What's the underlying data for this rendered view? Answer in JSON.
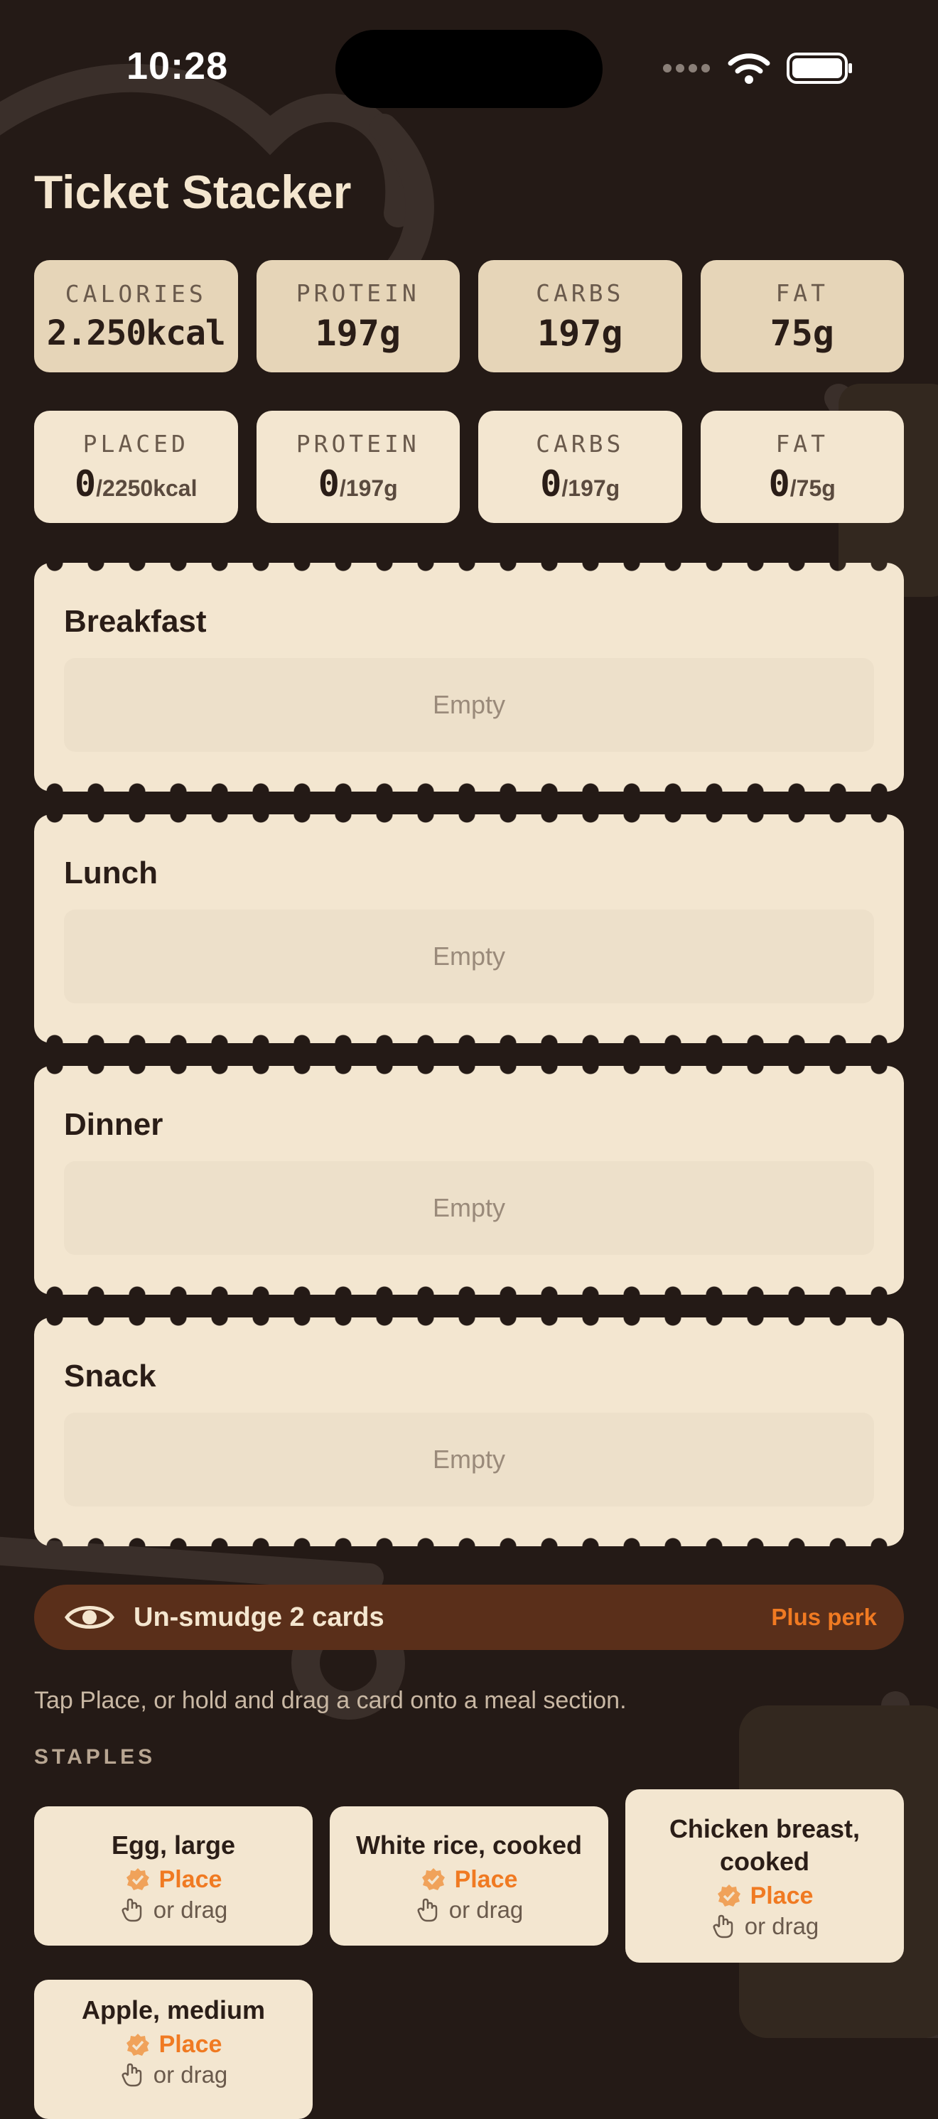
{
  "status_bar": {
    "time": "10:28"
  },
  "app": {
    "title": "Ticket Stacker"
  },
  "targets": [
    {
      "label": "CALORIES",
      "value": "2.250kcal"
    },
    {
      "label": "PROTEIN",
      "value": "197g"
    },
    {
      "label": "CARBS",
      "value": "197g"
    },
    {
      "label": "FAT",
      "value": "75g"
    }
  ],
  "placed": [
    {
      "label": "PLACED",
      "current": "0",
      "target": "/2250kcal"
    },
    {
      "label": "PROTEIN",
      "current": "0",
      "target": "/197g"
    },
    {
      "label": "CARBS",
      "current": "0",
      "target": "/197g"
    },
    {
      "label": "FAT",
      "current": "0",
      "target": "/75g"
    }
  ],
  "meals": [
    {
      "name": "Breakfast",
      "empty_text": "Empty"
    },
    {
      "name": "Lunch",
      "empty_text": "Empty"
    },
    {
      "name": "Dinner",
      "empty_text": "Empty"
    },
    {
      "name": "Snack",
      "empty_text": "Empty"
    }
  ],
  "perk": {
    "icon": "eye-icon",
    "label": "Un-smudge 2 cards",
    "tag": "Plus perk"
  },
  "hint": "Tap Place, or hold and drag a card onto a meal section.",
  "staples_label": "STAPLES",
  "staples": [
    {
      "name": "Egg, large",
      "place_label": "Place",
      "drag_label": "or drag"
    },
    {
      "name": "White rice, cooked",
      "place_label": "Place",
      "drag_label": "or drag"
    },
    {
      "name": "Chicken breast, cooked",
      "place_label": "Place",
      "drag_label": "or drag"
    },
    {
      "name": "Apple, medium",
      "place_label": "Place",
      "drag_label": "or drag"
    }
  ],
  "colors": {
    "background": "#241a16",
    "card": "#f3e6d0",
    "accent": "#f07a22",
    "perk_bg": "#5a2f1a"
  }
}
